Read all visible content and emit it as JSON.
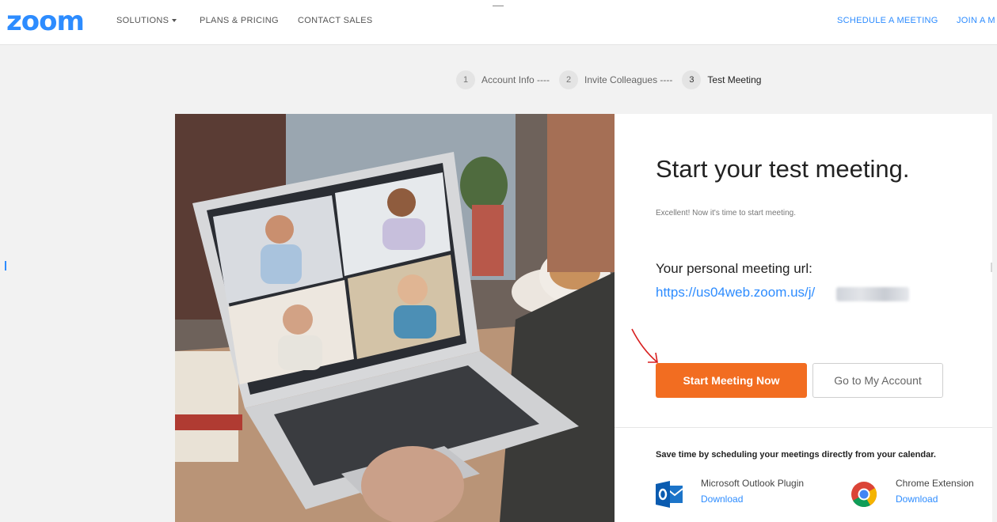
{
  "header": {
    "logo": "zoom",
    "nav": {
      "solutions": "SOLUTIONS",
      "plans": "PLANS & PRICING",
      "contact": "CONTACT SALES",
      "schedule": "SCHEDULE A MEETING",
      "join": "JOIN A M"
    }
  },
  "stepper": [
    {
      "num": "1",
      "label": "Account Info ----"
    },
    {
      "num": "2",
      "label": "Invite Colleagues ----"
    },
    {
      "num": "3",
      "label": "Test Meeting"
    }
  ],
  "card": {
    "title": "Start your test meeting.",
    "subtitle": "Excellent! Now it's time to start meeting.",
    "url_label": "Your personal meeting url:",
    "url_value": "https://us04web.zoom.us/j/",
    "start_button": "Start Meeting Now",
    "account_button": "Go to My Account",
    "calendar_note": "Save time by scheduling your meetings directly from your calendar.",
    "plugins": [
      {
        "name": "Microsoft Outlook Plugin",
        "link": "Download",
        "icon": "outlook-icon"
      },
      {
        "name": "Chrome Extension",
        "link": "Download",
        "icon": "chrome-icon"
      }
    ]
  },
  "colors": {
    "brand_blue": "#2d8cff",
    "accent_orange": "#f26d21",
    "annotation_red": "#d81f1f"
  }
}
